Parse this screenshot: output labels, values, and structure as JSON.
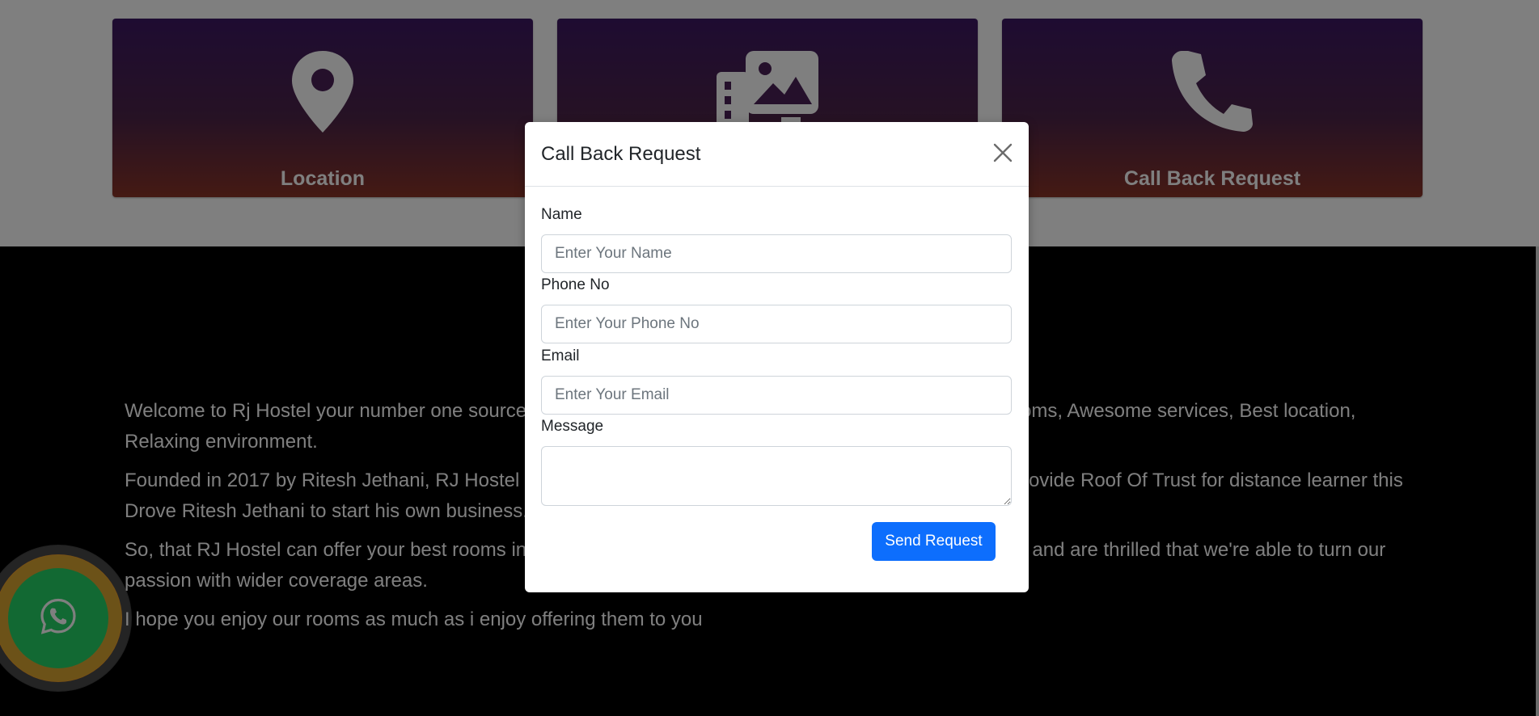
{
  "cards": [
    {
      "label": "Location",
      "icon": "map-pin-icon"
    },
    {
      "label": "",
      "icon": "gallery-icon"
    },
    {
      "label": "Call Back Request",
      "icon": "phone-icon"
    }
  ],
  "about": {
    "paragraphs": [
      "Welcome to Rj Hostel your number one source for all kind of rooms with focus of cleanness, Spacious rooms, Awesome services, Best location, Relaxing environment.",
      "Founded in 2017 by Ritesh Jethani, RJ Hostel has come a long way from its beginnings with an idea to provide Roof Of Trust for distance learner this Drove Ritesh Jethani to start his own business.",
      "So, that RJ Hostel can offer your best rooms in Aurangabad. We now serve students all over Aurangabad and are thrilled that we're able to turn our passion with wider coverage areas.",
      "I hope you enjoy our rooms as much as i enjoy offering them to you"
    ]
  },
  "whatsapp": {
    "icon": "whatsapp-icon",
    "color": "#25d366"
  },
  "modal": {
    "title": "Call Back Request",
    "close_icon": "close-icon",
    "fields": {
      "name": {
        "label": "Name",
        "placeholder": "Enter Your Name",
        "value": ""
      },
      "phone": {
        "label": "Phone No",
        "placeholder": "Enter Your Phone No",
        "value": ""
      },
      "email": {
        "label": "Email",
        "placeholder": "Enter Your Email",
        "value": ""
      },
      "message": {
        "label": "Message",
        "placeholder": "",
        "value": ""
      }
    },
    "submit_label": "Send Request"
  },
  "colors": {
    "card_gradient_top": "#3d1863",
    "card_gradient_bottom": "#8a3427",
    "primary_button": "#0d6efd",
    "backdrop": "rgba(0,0,0,0.5)"
  }
}
